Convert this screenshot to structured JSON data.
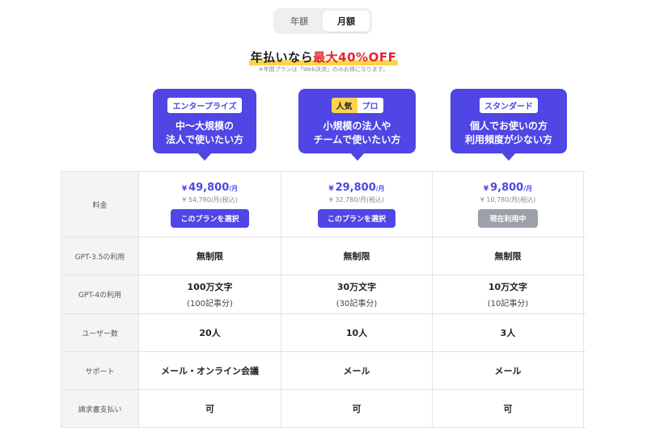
{
  "toggle": {
    "yearly": "年額",
    "monthly": "月額",
    "selected": "monthly"
  },
  "promo": {
    "prefix": "年払いなら",
    "highlight": "最大40%OFF",
    "note": "※年間プランは「Web決済」のみお得になります。"
  },
  "plans": [
    {
      "badge": "エンタープライズ",
      "desc_line1": "中〜大規模の",
      "desc_line2": "法人で使いたい方",
      "price": "49,800",
      "price_unit": "/月",
      "price_taxed": "¥ 54,780/月(税込)",
      "button": "このプランを選択",
      "current": false
    },
    {
      "popular_badge": "人気",
      "badge": "プロ",
      "desc_line1": "小規模の法人や",
      "desc_line2": "チームで使いたい方",
      "price": "29,800",
      "price_unit": "/月",
      "price_taxed": "¥ 32,780/月(税込)",
      "button": "このプランを選択",
      "current": false
    },
    {
      "badge": "スタンダード",
      "desc_line1": "個人でお使いの方",
      "desc_line2": "利用頻度が少ない方",
      "price": "9,800",
      "price_unit": "/月",
      "price_taxed": "¥ 10,780/月(税込)",
      "button": "現在利用中",
      "current": true
    }
  ],
  "currency_symbol": "¥",
  "table": {
    "price_label": "料金",
    "rows": [
      {
        "label": "GPT-3.5の利用",
        "values": [
          "無制限",
          "無制限",
          "無制限"
        ]
      },
      {
        "label": "GPT-4の利用",
        "values": [
          "100万文字",
          "30万文字",
          "10万文字"
        ],
        "subs": [
          "(100記事分)",
          "(30記事分)",
          "(10記事分)"
        ]
      },
      {
        "label": "ユーザー数",
        "values": [
          "20人",
          "10人",
          "3人"
        ]
      },
      {
        "label": "サポート",
        "values": [
          "メール・オンライン会議",
          "メール",
          "メール"
        ]
      },
      {
        "label": "請求書支払い",
        "values": [
          "可",
          "可",
          "可"
        ]
      }
    ]
  },
  "colors": {
    "accent": "#4f46e5",
    "promo_red": "#e3262f",
    "highlight_yellow": "#fcd34d",
    "disabled": "#9ca0a8"
  }
}
